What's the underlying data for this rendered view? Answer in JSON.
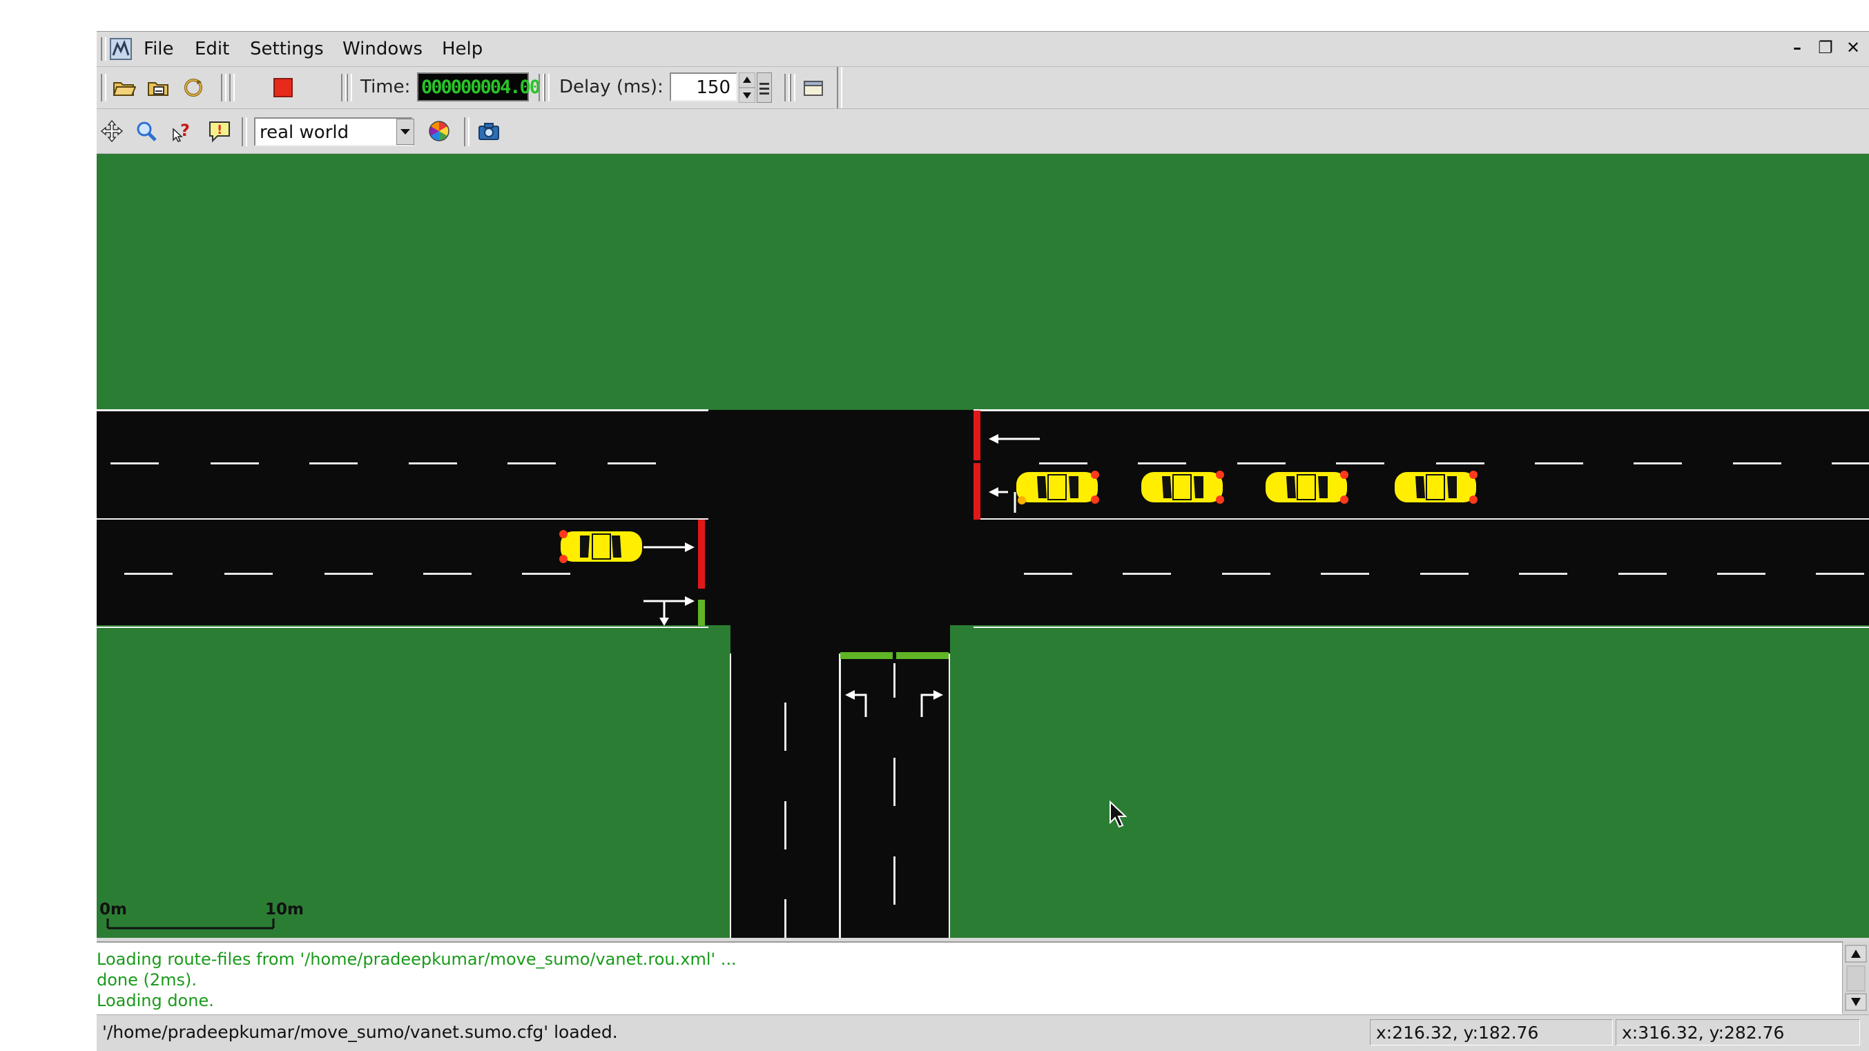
{
  "menubar": {
    "items": [
      "File",
      "Edit",
      "Settings",
      "Windows",
      "Help"
    ]
  },
  "window_controls": {
    "minimize": "–",
    "restore": "❐",
    "close": "✕"
  },
  "toolbar1": {
    "time_label": "Time:",
    "time_value": "000000004.00",
    "delay_label": "Delay (ms):",
    "delay_value": "150"
  },
  "toolbar2": {
    "scheme_selected": "real world"
  },
  "view": {
    "scale_start": "0m",
    "scale_end": "10m",
    "colors": {
      "grass": "#2b7d33",
      "road": "#0b0b0b",
      "car": "#ffee00",
      "signal_red": "#e01818",
      "signal_green": "#5fb526"
    },
    "vehicles": [
      {
        "id": "car-eastbound",
        "heading": "east"
      },
      {
        "id": "car-westbound-1",
        "heading": "west"
      },
      {
        "id": "car-westbound-2",
        "heading": "west"
      },
      {
        "id": "car-westbound-3",
        "heading": "west"
      },
      {
        "id": "car-westbound-4",
        "heading": "west"
      }
    ]
  },
  "log": {
    "lines": [
      "Loading route-files from '/home/pradeepkumar/move_sumo/vanet.rou.xml' ...",
      "done (2ms).",
      "Loading done."
    ]
  },
  "statusbar": {
    "message": "'/home/pradeepkumar/move_sumo/vanet.sumo.cfg' loaded.",
    "coords_1": "x:216.32, y:182.76",
    "coords_2": "x:316.32, y:282.76"
  }
}
